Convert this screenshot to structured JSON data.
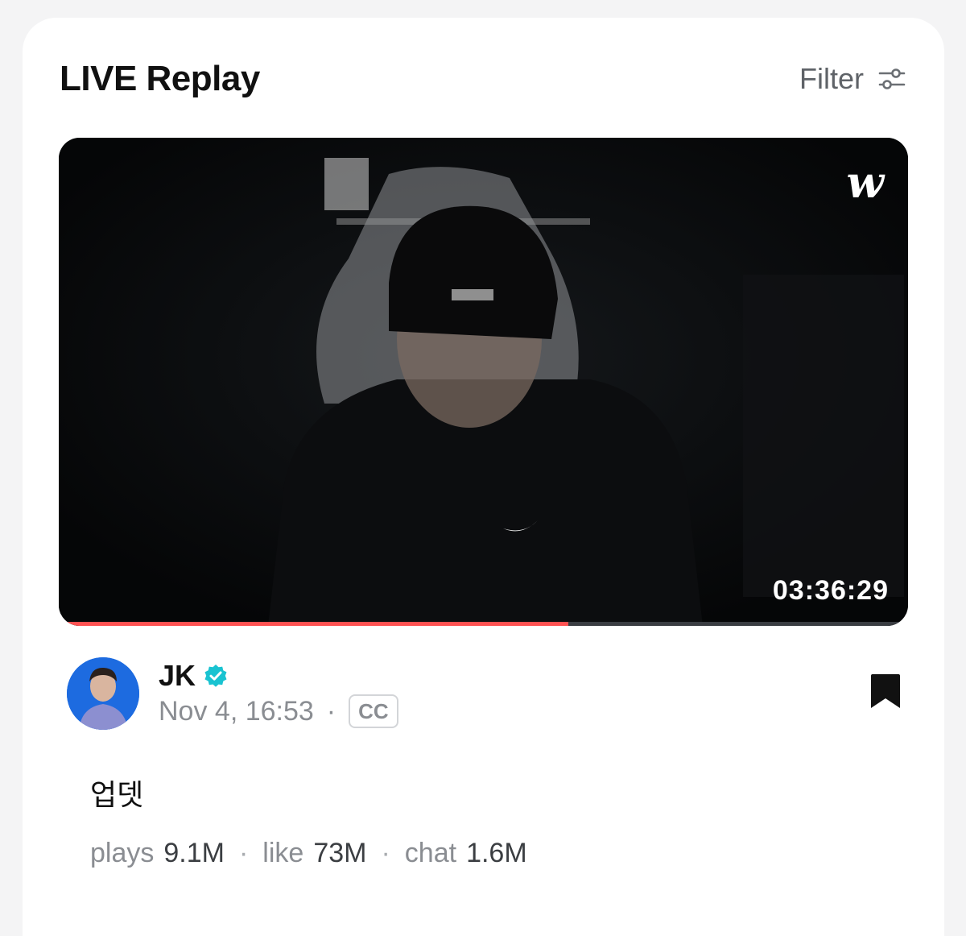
{
  "header": {
    "title": "LIVE Replay",
    "filter_label": "Filter"
  },
  "video": {
    "brand_mark": "w",
    "duration": "03:36:29",
    "progress": 0.6,
    "progress_color": "#ff5252",
    "thumbnail_description": "person in black beanie seated in gaming chair in a dark room"
  },
  "author": {
    "name": "JK",
    "verified": true,
    "verified_color": "#19c3d1",
    "date": "Nov 4, 16:53",
    "separator": "·",
    "cc_label": "CC"
  },
  "post": {
    "caption": "업뎃"
  },
  "stats": [
    {
      "label": "plays",
      "value": "9.1M"
    },
    {
      "label": "like",
      "value": "73M"
    },
    {
      "label": "chat",
      "value": "1.6M"
    }
  ]
}
